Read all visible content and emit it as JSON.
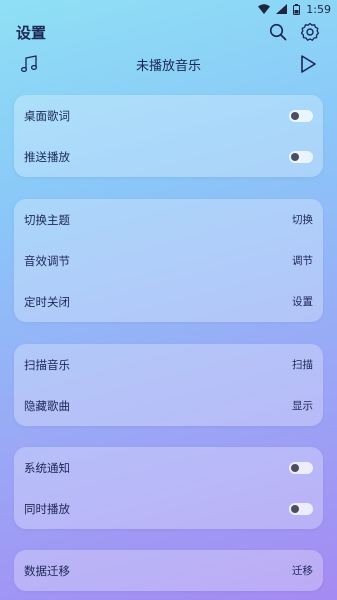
{
  "status_bar": {
    "time": "1:59"
  },
  "header": {
    "title": "设置"
  },
  "player": {
    "now_playing": "未播放音乐"
  },
  "sections": [
    {
      "items": [
        {
          "label": "桌面歌词",
          "type": "toggle",
          "on": false
        },
        {
          "label": "推送播放",
          "type": "toggle",
          "on": false
        }
      ]
    },
    {
      "items": [
        {
          "label": "切换主题",
          "type": "action",
          "action": "切换"
        },
        {
          "label": "音效调节",
          "type": "action",
          "action": "调节"
        },
        {
          "label": "定时关闭",
          "type": "action",
          "action": "设置"
        }
      ]
    },
    {
      "items": [
        {
          "label": "扫描音乐",
          "type": "action",
          "action": "扫描"
        },
        {
          "label": "隐藏歌曲",
          "type": "action",
          "action": "显示"
        }
      ]
    },
    {
      "items": [
        {
          "label": "系统通知",
          "type": "toggle",
          "on": false
        },
        {
          "label": "同时播放",
          "type": "toggle",
          "on": false
        }
      ]
    },
    {
      "items": [
        {
          "label": "数据迁移",
          "type": "action",
          "action": "迁移"
        }
      ]
    }
  ],
  "icons": {
    "music": "music-note-icon",
    "play": "play-icon",
    "search": "search-icon",
    "settings": "gear-icon"
  }
}
